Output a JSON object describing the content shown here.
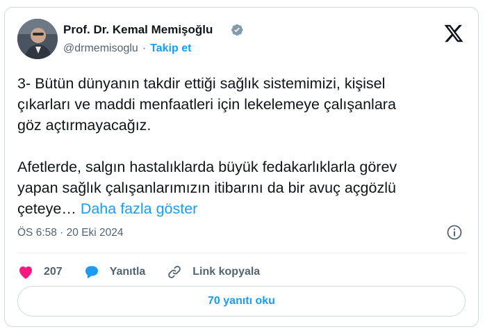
{
  "author": {
    "name": "Prof. Dr. Kemal Memişoğlu",
    "handle": "@drmemisoglu",
    "separator": "·",
    "follow_label": "Takip et"
  },
  "tweet": {
    "text": "3- Bütün dünyanın takdir ettiği sağlık sistemimizi, kişisel\nçıkarları ve maddi menfaatleri için lekelemeye çalışanlara\ngöz açtırmayacağız.\n\nAfetlerde, salgın hastalıklarda büyük fedakarlıklarla görev\nyapan sağlık çalışanlarımızın itibarını da bir avuç açgözlü\nçeteye… ",
    "show_more": "Daha fazla göster",
    "timestamp": "ÖS 6:58 · 20 Eki 2024"
  },
  "actions": {
    "likes": "207",
    "reply_label": "Yanıtla",
    "copy_link_label": "Link kopyala",
    "read_replies_label": "70 yanıtı oku"
  },
  "colors": {
    "accent": "#1d9bf0",
    "like": "#f91880",
    "muted": "#536471",
    "border": "#cfd9de"
  },
  "icons": [
    "verified-badge-icon",
    "x-logo-icon",
    "info-icon",
    "heart-icon",
    "reply-bubble-icon",
    "link-icon"
  ]
}
